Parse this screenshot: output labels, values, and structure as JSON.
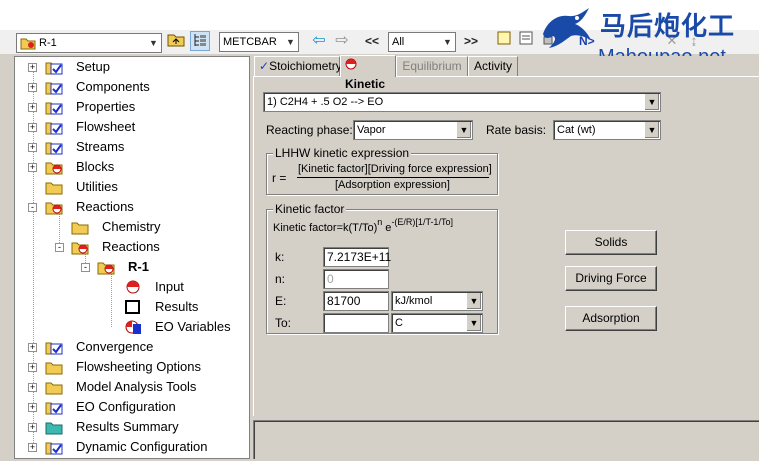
{
  "toolbar": {
    "object_select": "R-1",
    "units_set": "METCBAR",
    "nav_filter": "All",
    "prev_label": "<<",
    "next_label": ">>",
    "next_step_label": "N>"
  },
  "watermark": {
    "cn": "马后炮化工",
    "en": "Mahoupao.net"
  },
  "tree": [
    {
      "label": "Setup",
      "indent": 0,
      "expander": "+",
      "icon": "folder-check"
    },
    {
      "label": "Components",
      "indent": 0,
      "expander": "+",
      "icon": "folder-check"
    },
    {
      "label": "Properties",
      "indent": 0,
      "expander": "+",
      "icon": "folder-check"
    },
    {
      "label": "Flowsheet",
      "indent": 0,
      "expander": "+",
      "icon": "folder-check"
    },
    {
      "label": "Streams",
      "indent": 0,
      "expander": "+",
      "icon": "folder-check"
    },
    {
      "label": "Blocks",
      "indent": 0,
      "expander": "+",
      "icon": "folder-half"
    },
    {
      "label": "Utilities",
      "indent": 0,
      "expander": "",
      "icon": "folder"
    },
    {
      "label": "Reactions",
      "indent": 0,
      "expander": "-",
      "icon": "folder-half"
    },
    {
      "label": "Chemistry",
      "indent": 1,
      "expander": "",
      "icon": "folder"
    },
    {
      "label": "Reactions",
      "indent": 1,
      "expander": "-",
      "icon": "folder-half"
    },
    {
      "label": "R-1",
      "indent": 2,
      "expander": "-",
      "icon": "folder-half",
      "bold": true
    },
    {
      "label": "Input",
      "indent": 3,
      "expander": "",
      "icon": "half-circle"
    },
    {
      "label": "Results",
      "indent": 3,
      "expander": "",
      "icon": "square"
    },
    {
      "label": "EO Variables",
      "indent": 3,
      "expander": "",
      "icon": "eo-vars"
    },
    {
      "label": "Convergence",
      "indent": 0,
      "expander": "+",
      "icon": "folder-check"
    },
    {
      "label": "Flowsheeting Options",
      "indent": 0,
      "expander": "+",
      "icon": "folder"
    },
    {
      "label": "Model Analysis Tools",
      "indent": 0,
      "expander": "+",
      "icon": "folder"
    },
    {
      "label": "EO Configuration",
      "indent": 0,
      "expander": "+",
      "icon": "folder-check"
    },
    {
      "label": "Results Summary",
      "indent": 0,
      "expander": "+",
      "icon": "folder-teal"
    },
    {
      "label": "Dynamic Configuration",
      "indent": 0,
      "expander": "+",
      "icon": "folder-check"
    }
  ],
  "tabs": [
    {
      "label": "Stoichiometry",
      "state": "complete"
    },
    {
      "label": "Kinetic",
      "state": "active"
    },
    {
      "label": "Equilibrium",
      "state": "disabled"
    },
    {
      "label": "Activity",
      "state": "normal"
    }
  ],
  "kinetic": {
    "reaction_select": "1) C2H4 + .5 O2 -->  EO",
    "reacting_phase_label": "Reacting phase:",
    "reacting_phase_value": "Vapor",
    "rate_basis_label": "Rate basis:",
    "rate_basis_value": "Cat (wt)",
    "lhhw_title": "LHHW kinetic expression",
    "r_eq": "r =",
    "numerator": "[Kinetic factor][Driving force expression]",
    "denominator": "[Adsorption expression]",
    "kf_title": "Kinetic factor",
    "kf_formula_a": "Kinetic factor=k(T/To)",
    "kf_formula_n": "n",
    "kf_formula_e": " e",
    "kf_formula_exp": "-(E/R)[1/T-1/To]",
    "k_label": "k:",
    "k_value": "7.2173E+11",
    "n_label": "n:",
    "n_value": "0",
    "E_label": "E:",
    "E_value": "81700",
    "E_units": "kJ/kmol",
    "To_label": "To:",
    "To_value": "",
    "To_units": "C",
    "btn_solids": "Solids",
    "btn_driving": "Driving Force",
    "btn_adsorption": "Adsorption"
  }
}
